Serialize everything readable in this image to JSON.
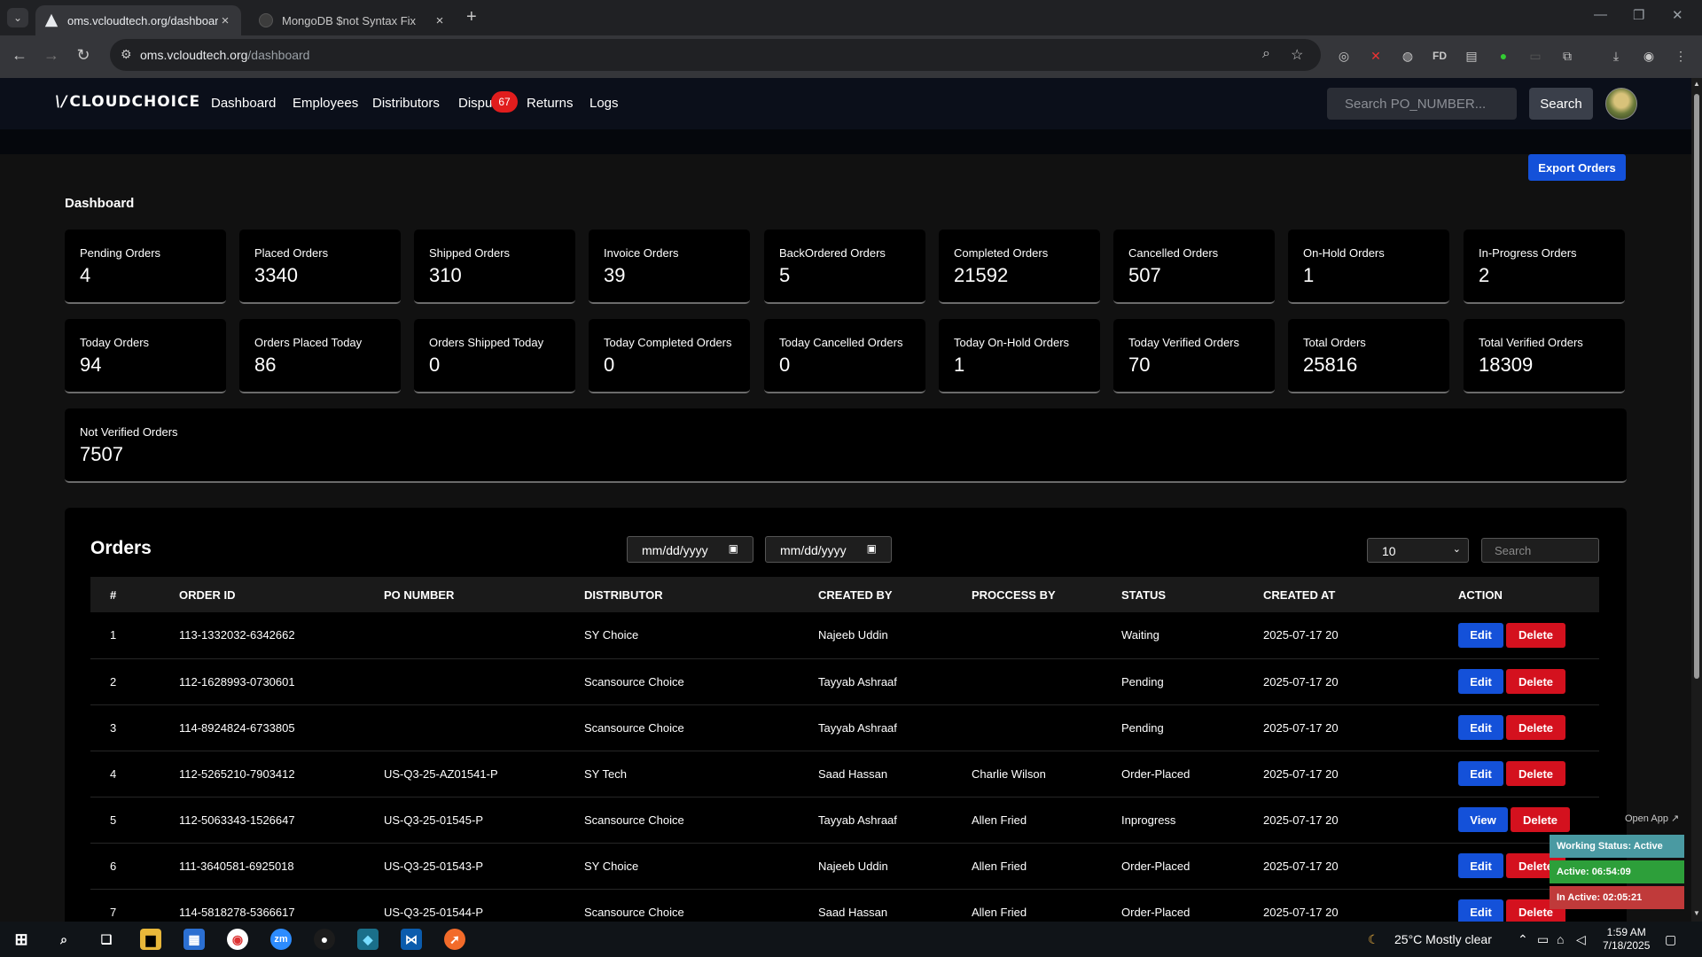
{
  "browser": {
    "tabs": [
      {
        "title": "oms.vcloudtech.org/dashboard",
        "active": true
      },
      {
        "title": "MongoDB $not Syntax Fix",
        "active": false
      }
    ],
    "url_host": "oms.vcloudtech.org",
    "url_path": "/dashboard",
    "extension_labels": [
      "FD"
    ]
  },
  "nav": {
    "logo_mark": "\\/",
    "logo_text": "CLOUDCHOICE",
    "links": [
      "Dashboard",
      "Employees",
      "Distributors",
      "Dispu",
      "Returns",
      "Logs"
    ],
    "disputes_badge": "67",
    "search_placeholder": "Search PO_NUMBER...",
    "search_button": "Search"
  },
  "dashboard": {
    "export_button": "Export Orders",
    "title": "Dashboard",
    "stats_row1": [
      {
        "label": "Pending Orders",
        "value": "4"
      },
      {
        "label": "Placed Orders",
        "value": "3340"
      },
      {
        "label": "Shipped Orders",
        "value": "310"
      },
      {
        "label": "Invoice Orders",
        "value": "39"
      },
      {
        "label": "BackOrdered Orders",
        "value": "5"
      },
      {
        "label": "Completed Orders",
        "value": "21592"
      },
      {
        "label": "Cancelled Orders",
        "value": "507"
      },
      {
        "label": "On-Hold Orders",
        "value": "1"
      },
      {
        "label": "In-Progress Orders",
        "value": "2"
      }
    ],
    "stats_row2": [
      {
        "label": "Today Orders",
        "value": "94"
      },
      {
        "label": "Orders Placed Today",
        "value": "86"
      },
      {
        "label": "Orders Shipped Today",
        "value": "0"
      },
      {
        "label": "Today Completed Orders",
        "value": "0"
      },
      {
        "label": "Today Cancelled Orders",
        "value": "0"
      },
      {
        "label": "Today On-Hold Orders",
        "value": "1"
      },
      {
        "label": "Today Verified Orders",
        "value": "70"
      },
      {
        "label": "Total Orders",
        "value": "25816"
      },
      {
        "label": "Total Verified Orders",
        "value": "18309"
      }
    ],
    "not_verified": {
      "label": "Not Verified Orders",
      "value": "7507"
    }
  },
  "orders": {
    "title": "Orders",
    "date_from_placeholder": "mm/dd/yyyy",
    "date_to_placeholder": "mm/dd/yyyy",
    "page_size": "10",
    "search_placeholder": "Search",
    "columns": [
      "#",
      "ORDER ID",
      "PO NUMBER",
      "DISTRIBUTOR",
      "CREATED BY",
      "PROCCESS BY",
      "STATUS",
      "CREATED AT",
      "ACTION"
    ],
    "edit_label": "Edit",
    "view_label": "View",
    "delete_label": "Delete",
    "rows": [
      {
        "n": "1",
        "order_id": "113-1332032-6342662",
        "po": "",
        "distributor": "SY Choice",
        "created_by": "Najeeb Uddin",
        "process_by": "",
        "status": "Waiting",
        "created_at": "2025-07-17 20",
        "primary": "Edit"
      },
      {
        "n": "2",
        "order_id": "112-1628993-0730601",
        "po": "",
        "distributor": "Scansource Choice",
        "created_by": "Tayyab Ashraaf",
        "process_by": "",
        "status": "Pending",
        "created_at": "2025-07-17 20",
        "primary": "Edit"
      },
      {
        "n": "3",
        "order_id": "114-8924824-6733805",
        "po": "",
        "distributor": "Scansource Choice",
        "created_by": "Tayyab Ashraaf",
        "process_by": "",
        "status": "Pending",
        "created_at": "2025-07-17 20",
        "primary": "Edit"
      },
      {
        "n": "4",
        "order_id": "112-5265210-7903412",
        "po": "US-Q3-25-AZ01541-P",
        "distributor": "SY Tech",
        "created_by": "Saad Hassan",
        "process_by": "Charlie Wilson",
        "status": "Order-Placed",
        "created_at": "2025-07-17 20",
        "primary": "Edit"
      },
      {
        "n": "5",
        "order_id": "112-5063343-1526647",
        "po": "US-Q3-25-01545-P",
        "distributor": "Scansource Choice",
        "created_by": "Tayyab Ashraaf",
        "process_by": "Allen Fried",
        "status": "Inprogress",
        "created_at": "2025-07-17 20",
        "primary": "View"
      },
      {
        "n": "6",
        "order_id": "111-3640581-6925018",
        "po": "US-Q3-25-01543-P",
        "distributor": "SY Choice",
        "created_by": "Najeeb Uddin",
        "process_by": "Allen Fried",
        "status": "Order-Placed",
        "created_at": "2025-07-17 20",
        "primary": "Edit"
      },
      {
        "n": "7",
        "order_id": "114-5818278-5366617",
        "po": "US-Q3-25-01544-P",
        "distributor": "Scansource Choice",
        "created_by": "Saad Hassan",
        "process_by": "Allen Fried",
        "status": "Order-Placed",
        "created_at": "2025-07-17 20",
        "primary": "Edit"
      }
    ]
  },
  "widget": {
    "open_app": "Open App ↗",
    "working_status": "Working Status: Active",
    "active_time": "Active: 06:54:09",
    "inactive_time": "In Active: 02:05:21",
    "colors": {
      "status": "#4a9aa2",
      "active": "#2d9f3a",
      "inactive": "#c03a3a"
    }
  },
  "taskbar": {
    "weather": "25°C  Mostly clear",
    "time": "1:59 AM",
    "date": "7/18/2025"
  },
  "colors": {
    "accent": "#1451d9",
    "danger": "#d4111e",
    "badge": "#e11d1d"
  }
}
